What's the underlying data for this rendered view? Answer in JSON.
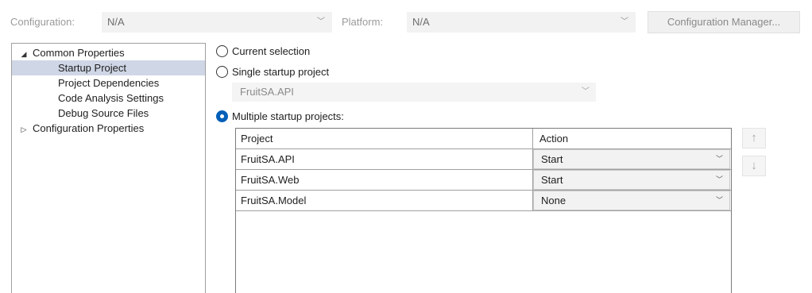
{
  "toolbar": {
    "configuration_label": "Configuration:",
    "configuration_value": "N/A",
    "platform_label": "Platform:",
    "platform_value": "N/A",
    "configuration_manager_label": "Configuration Manager..."
  },
  "tree": {
    "common_properties": "Common Properties",
    "items": [
      {
        "label": "Startup Project",
        "selected": true
      },
      {
        "label": "Project Dependencies"
      },
      {
        "label": "Code Analysis Settings"
      },
      {
        "label": "Debug Source Files"
      }
    ],
    "configuration_properties": "Configuration Properties"
  },
  "startup": {
    "current_selection_label": "Current selection",
    "single_startup_label": "Single startup project",
    "single_startup_value": "FruitSA.API",
    "multiple_startup_label": "Multiple startup projects:",
    "selected_option": "multiple"
  },
  "grid": {
    "columns": [
      "Project",
      "Action"
    ],
    "rows": [
      {
        "project": "FruitSA.API",
        "action": "Start"
      },
      {
        "project": "FruitSA.Web",
        "action": "Start"
      },
      {
        "project": "FruitSA.Model",
        "action": "None"
      }
    ]
  },
  "icons": {
    "move_up": "arrow-up-icon",
    "move_down": "arrow-down-icon"
  },
  "colors": {
    "accent": "#005fb8",
    "selection_bg": "#cfd6e5"
  }
}
